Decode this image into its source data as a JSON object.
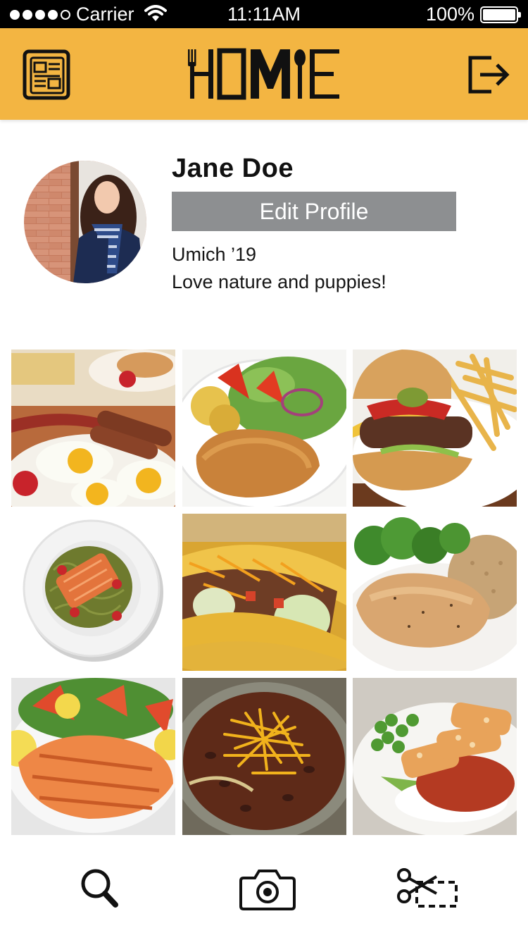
{
  "status_bar": {
    "carrier": "Carrier",
    "time": "11:11AM",
    "battery": "100%",
    "signal_bars_filled": 4,
    "signal_bars_total": 5
  },
  "header": {
    "logo_text": "HOME",
    "left_icon": "newspaper-icon",
    "right_icon": "logout-icon",
    "background": "#f3b542"
  },
  "profile": {
    "name": "Jane Doe",
    "edit_button": "Edit Profile",
    "school": "Umich ’19",
    "bio": "Love nature and puppies!"
  },
  "photos": [
    {
      "subject": "breakfast"
    },
    {
      "subject": "schnitzel with salad"
    },
    {
      "subject": "cheeseburger with fries"
    },
    {
      "subject": "salmon with pesto pasta"
    },
    {
      "subject": "tacos"
    },
    {
      "subject": "chicken breast with broccoli and rice"
    },
    {
      "subject": "grilled salmon salad"
    },
    {
      "subject": "chili with cheese"
    },
    {
      "subject": "fried chicken cutlet with rice"
    }
  ],
  "tab_bar": {
    "items": [
      {
        "icon": "search-icon"
      },
      {
        "icon": "camera-icon"
      },
      {
        "icon": "scissors-crop-icon"
      }
    ]
  },
  "colors": {
    "accent": "#f3b542",
    "button_gray": "#8d8f91"
  }
}
